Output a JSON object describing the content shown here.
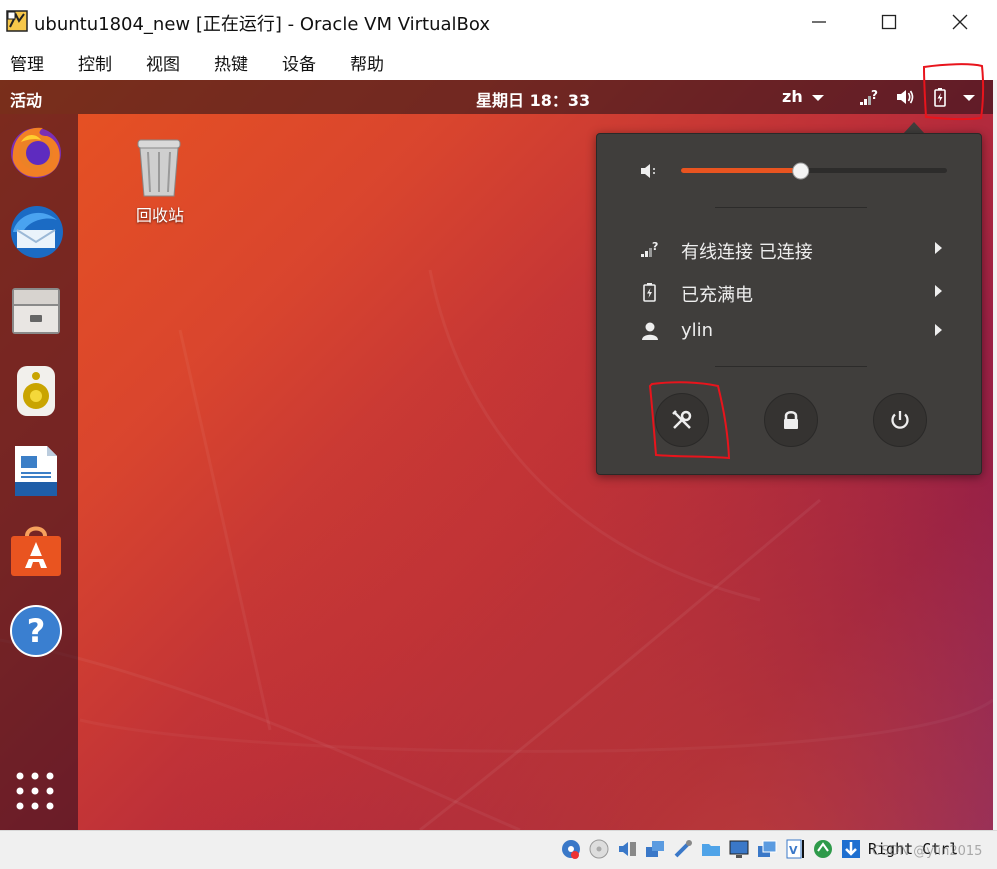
{
  "window": {
    "title": "ubuntu1804_new [正在运行] - Oracle VM VirtualBox",
    "controls": [
      "minimize",
      "maximize",
      "close"
    ]
  },
  "menubar": {
    "items": [
      "管理",
      "控制",
      "视图",
      "热键",
      "设备",
      "帮助"
    ]
  },
  "topbar": {
    "activities": "活动",
    "clock": "星期日 18：33",
    "input_method": "zh",
    "icons": [
      "network-question-icon",
      "volume-icon",
      "battery-charging-icon",
      "system-menu-arrow-icon"
    ]
  },
  "dock": {
    "apps": [
      "firefox-icon",
      "thunderbird-icon",
      "files-icon",
      "rhythmbox-icon",
      "libreoffice-writer-icon",
      "ubuntu-software-icon",
      "help-icon"
    ],
    "show_apps": "show-applications-icon"
  },
  "desktop": {
    "trash_label": "回收站"
  },
  "system_menu": {
    "volume_level": 0.45,
    "rows": [
      {
        "icon": "wired-network-icon",
        "label": "有线连接 已连接"
      },
      {
        "icon": "battery-full-icon",
        "label": "已充满电"
      },
      {
        "icon": "user-icon",
        "label": "ylin"
      }
    ],
    "buttons": [
      "settings-button",
      "lock-button",
      "power-off-button"
    ]
  },
  "statusbar": {
    "host_key": "Right Ctrl",
    "watermark": "CSDN @ylin2015"
  },
  "colors": {
    "ubuntu_orange": "#e95420",
    "aubergine": "#77216f",
    "panel_bg": "#403e3c",
    "annotation_red": "#e8141c"
  }
}
